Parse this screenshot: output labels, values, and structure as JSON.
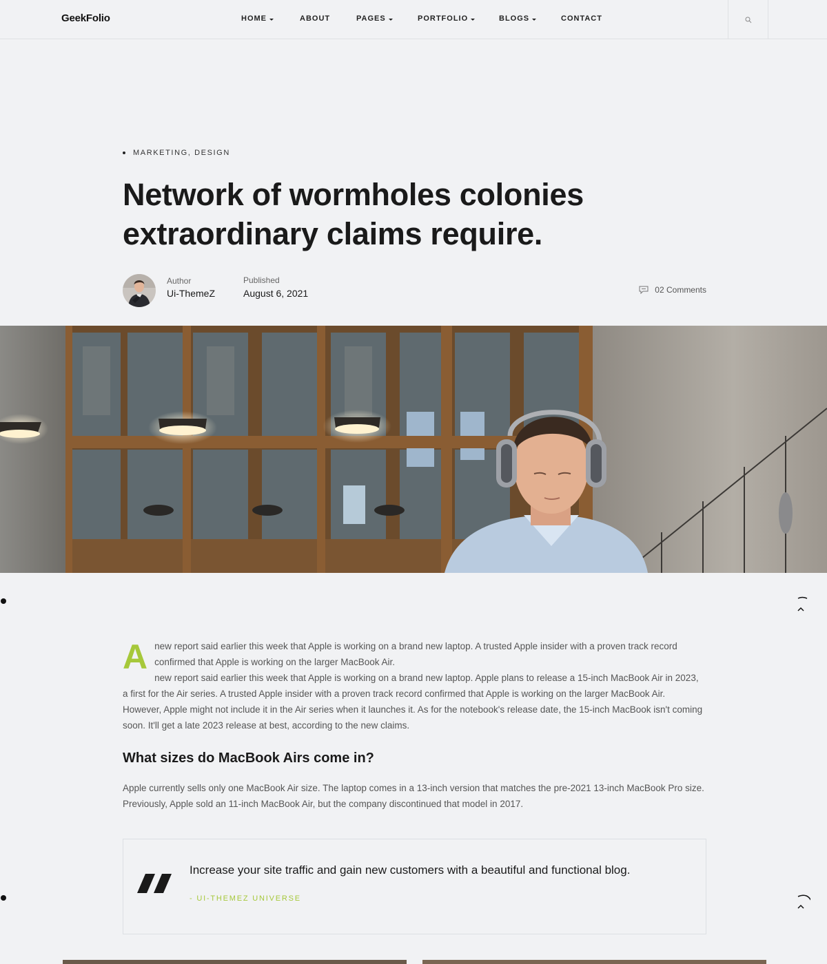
{
  "header": {
    "logo": "GeekFolio",
    "nav": [
      {
        "label": "HOME",
        "has_dropdown": true
      },
      {
        "label": "ABOUT",
        "has_dropdown": false
      },
      {
        "label": "PAGES",
        "has_dropdown": true
      },
      {
        "label": "PORTFOLIO",
        "has_dropdown": true
      },
      {
        "label": "BLOGS",
        "has_dropdown": true
      },
      {
        "label": "CONTACT",
        "has_dropdown": false
      }
    ],
    "search_icon": "search-icon"
  },
  "post": {
    "categories": [
      "MARKETING",
      "DESIGN"
    ],
    "category_separator": ",",
    "title": "Network of wormholes colonies extraordinary claims require.",
    "author_label": "Author",
    "author_name": "Ui-ThemeZ",
    "published_label": "Published",
    "published_date": "August 6, 2021",
    "comments": "02 Comments",
    "comments_icon": "comment-icon"
  },
  "article": {
    "dropcap": "A",
    "paragraph1_lead": "new report said earlier this week that Apple is working on a brand new laptop. A trusted Apple insider with a proven track record confirmed that Apple is working on the larger MacBook Air.",
    "paragraph1_rest": "new report said earlier this week that Apple is working on a brand new laptop. Apple plans to release a 15-inch MacBook Air in 2023, a first for the Air series. A trusted Apple insider with a proven track record confirmed that Apple is working on the larger MacBook Air. However, Apple might not include it in the Air series when it launches it. As for the notebook's release date, the 15-inch MacBook isn't coming soon. It'll get a late 2023 release at best, according to the new claims.",
    "heading": "What sizes do MacBook Airs come in?",
    "paragraph2": "Apple currently sells only one MacBook Air size. The laptop comes in a 13-inch version that matches the pre-2021 13-inch MacBook Pro size. Previously, Apple sold an 11-inch MacBook Air, but the company discontinued that model in 2017.",
    "quote": "Increase your site traffic and gain new customers with a beautiful and functional blog.",
    "quote_author": "- UI-THEMEZ UNIVERSE"
  },
  "colors": {
    "accent": "#a6c83a",
    "background": "#f1f2f4",
    "text": "#1a1a1a"
  }
}
